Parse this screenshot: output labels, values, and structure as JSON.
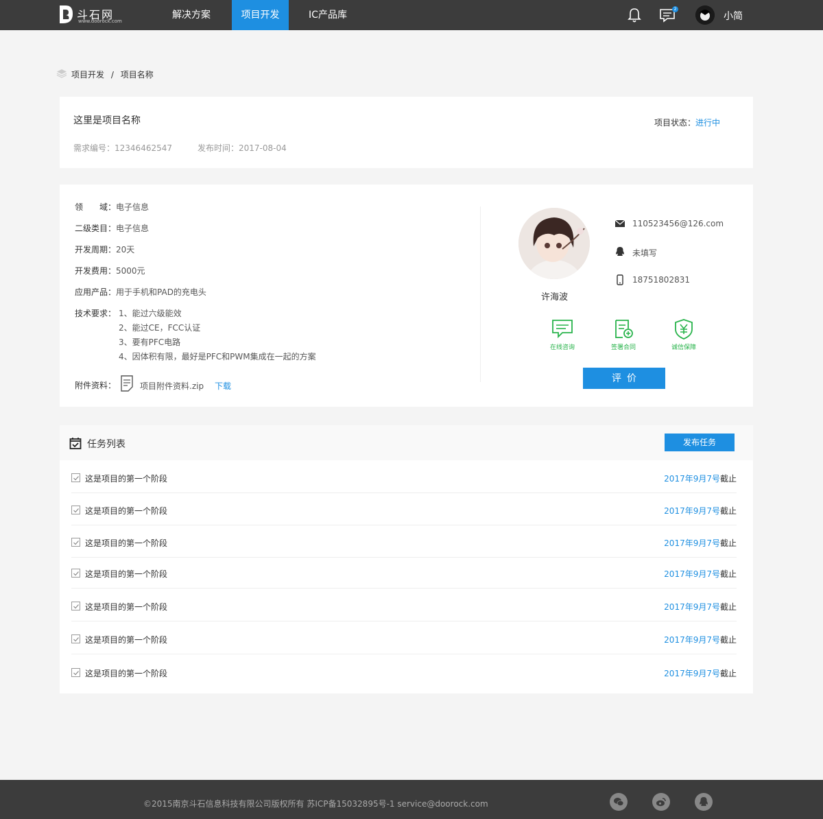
{
  "header": {
    "logo_name": "斗石网",
    "logo_domain": "www.doorock.com",
    "nav": [
      {
        "label": "解决方案"
      },
      {
        "label": "项目开发"
      },
      {
        "label": "IC产品库"
      }
    ],
    "message_badge": "2",
    "user_name": "小简"
  },
  "breadcrumb": {
    "parent": "项目开发",
    "separator": "/",
    "current": "项目名称"
  },
  "project": {
    "title": "这里是项目名称",
    "req_no_label": "需求编号：",
    "req_no": "12346462547",
    "pub_time_label": "发布时间：",
    "pub_time": "2017-08-04",
    "status_label": "项目状态：",
    "status": "进行中"
  },
  "details": {
    "field_label": "领　　域：",
    "field": "电子信息",
    "subcat_label": "二级类目：",
    "subcat": "电子信息",
    "cycle_label": "开发周期：",
    "cycle": "20天",
    "cost_label": "开发费用：",
    "cost": "5000元",
    "product_label": "应用产品：",
    "product": "用于手机和PAD的充电头",
    "tech_label": "技术要求：",
    "tech": [
      "1、能过六级能效",
      "2、能过CE，FCC认证",
      "3、要有PFC电路",
      "4、因体积有限，最好是PFC和PWM集成在一起的方案"
    ],
    "attach_label": "附件资料：",
    "attach_file": "项目附件资料.zip",
    "attach_download": "下载"
  },
  "contact": {
    "name": "许海波",
    "email": "110523456@126.com",
    "qq": "未填写",
    "phone": "18751802831",
    "actions": [
      {
        "label": "在线咨询",
        "icon": "chat-icon"
      },
      {
        "label": "签署合同",
        "icon": "contract-icon"
      },
      {
        "label": "诚信保障",
        "icon": "shield-yen-icon"
      }
    ],
    "eval_label": "评价"
  },
  "tasks": {
    "title": "任务列表",
    "publish_label": "发布任务",
    "items": [
      {
        "name": "这是项目的第一个阶段",
        "due": "2017年9月7号",
        "suffix": "截止"
      },
      {
        "name": "这是项目的第一个阶段",
        "due": "2017年9月7号",
        "suffix": "截止"
      },
      {
        "name": "这是项目的第一个阶段",
        "due": "2017年9月7号",
        "suffix": "截止"
      },
      {
        "name": "这是项目的第一个阶段",
        "due": "2017年9月7号",
        "suffix": "截止"
      },
      {
        "name": "这是项目的第一个阶段",
        "due": "2017年9月7号",
        "suffix": "截止"
      },
      {
        "name": "这是项目的第一个阶段",
        "due": "2017年9月7号",
        "suffix": "截止"
      },
      {
        "name": "这是项目的第一个阶段",
        "due": "2017年9月7号",
        "suffix": "截止"
      }
    ]
  },
  "footer": {
    "copyright": "©2015南京斗石信息科技有限公司版权所有 苏ICP备15032895号-1 service@doorock.com",
    "social": [
      "wechat-icon",
      "weibo-icon",
      "qq-icon"
    ]
  },
  "colors": {
    "accent": "#1e8fe1",
    "topbar": "#3c3c3c",
    "green": "#27b34a"
  }
}
